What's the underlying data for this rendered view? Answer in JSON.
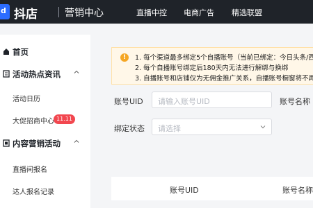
{
  "header": {
    "logo_glyph": "d",
    "brand": "抖店",
    "subtitle": "营销中心",
    "nav": [
      "直播中控",
      "电商广告",
      "精选联盟"
    ]
  },
  "sidebar": {
    "home": "首页",
    "group1": {
      "label": "活动热点资讯",
      "items": [
        "活动日历",
        "大促招商中心"
      ],
      "badge": "11.11"
    },
    "group2": {
      "label": "内容营销活动",
      "items": [
        "直播间报名",
        "达人报名记录"
      ]
    }
  },
  "notice": {
    "lines": [
      "1. 每个渠道最多绑定5个自播账号（当前已绑定：今日头条/西瓜",
      "2. 每个自播账号绑定后180天内无法进行解绑与换绑",
      "3. 自播账号和店铺仅为无佣金推广关系，自播账号橱窗将不再显"
    ]
  },
  "form": {
    "uid_label": "账号UID",
    "uid_placeholder": "请输入账号UID",
    "name_label": "账号名称",
    "status_label": "绑定状态",
    "status_placeholder": "请选择"
  },
  "table": {
    "columns": [
      "账号UID",
      "账号名称"
    ]
  },
  "colors": {
    "topbar": "#1f2329",
    "brand_blue": "#2b6cff",
    "badge_red": "#f2474f",
    "notice_bg": "#fff7e8",
    "notice_icon": "#f5a623"
  }
}
